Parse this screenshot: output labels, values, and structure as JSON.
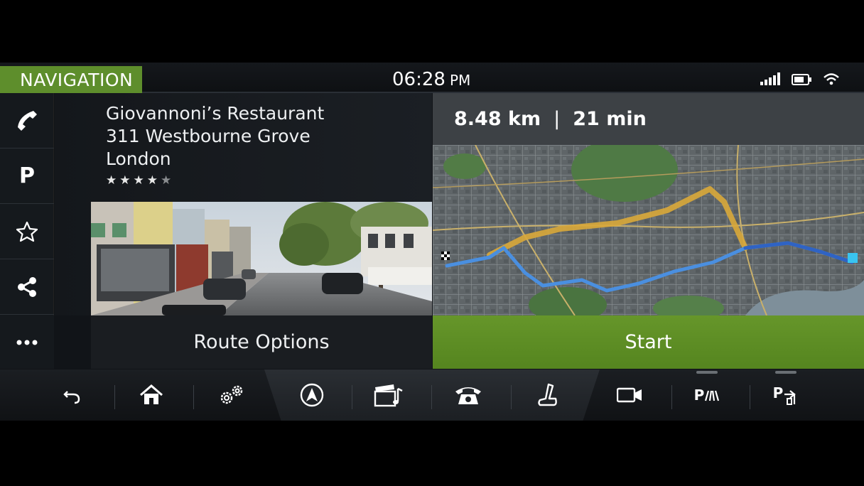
{
  "status_bar": {
    "section": "NAVIGATION",
    "time": "06:28",
    "ampm": "PM",
    "icons": [
      "signal-icon",
      "battery-icon",
      "wifi-icon"
    ]
  },
  "rail": {
    "items": [
      "phone-icon",
      "parking-icon",
      "star-outline-icon",
      "share-icon",
      "more-icon"
    ],
    "parking_label": "P"
  },
  "destination": {
    "name": "Giovannoni’s Restaurant",
    "street": "311 Westbourne Grove",
    "city": "London",
    "rating": 4,
    "rating_max": 5
  },
  "route": {
    "distance": "8.48 km",
    "separator": "|",
    "duration": "21 min"
  },
  "buttons": {
    "route_options": "Route Options",
    "start": "Start"
  },
  "dock": {
    "items": [
      "back-icon",
      "home-icon",
      "settings-icon",
      "navigation-icon",
      "media-icon",
      "phone-icon",
      "seat-icon",
      "camera-icon",
      "parking-aid-icon",
      "park-assist-icon"
    ],
    "parking_aid_label": "P",
    "park_assist_label": "P"
  },
  "colors": {
    "accent_green": "#5e8e2c",
    "start_green": "#5f8f26",
    "route_blue": "#3b82d6",
    "route_orange": "#d9a83a"
  }
}
